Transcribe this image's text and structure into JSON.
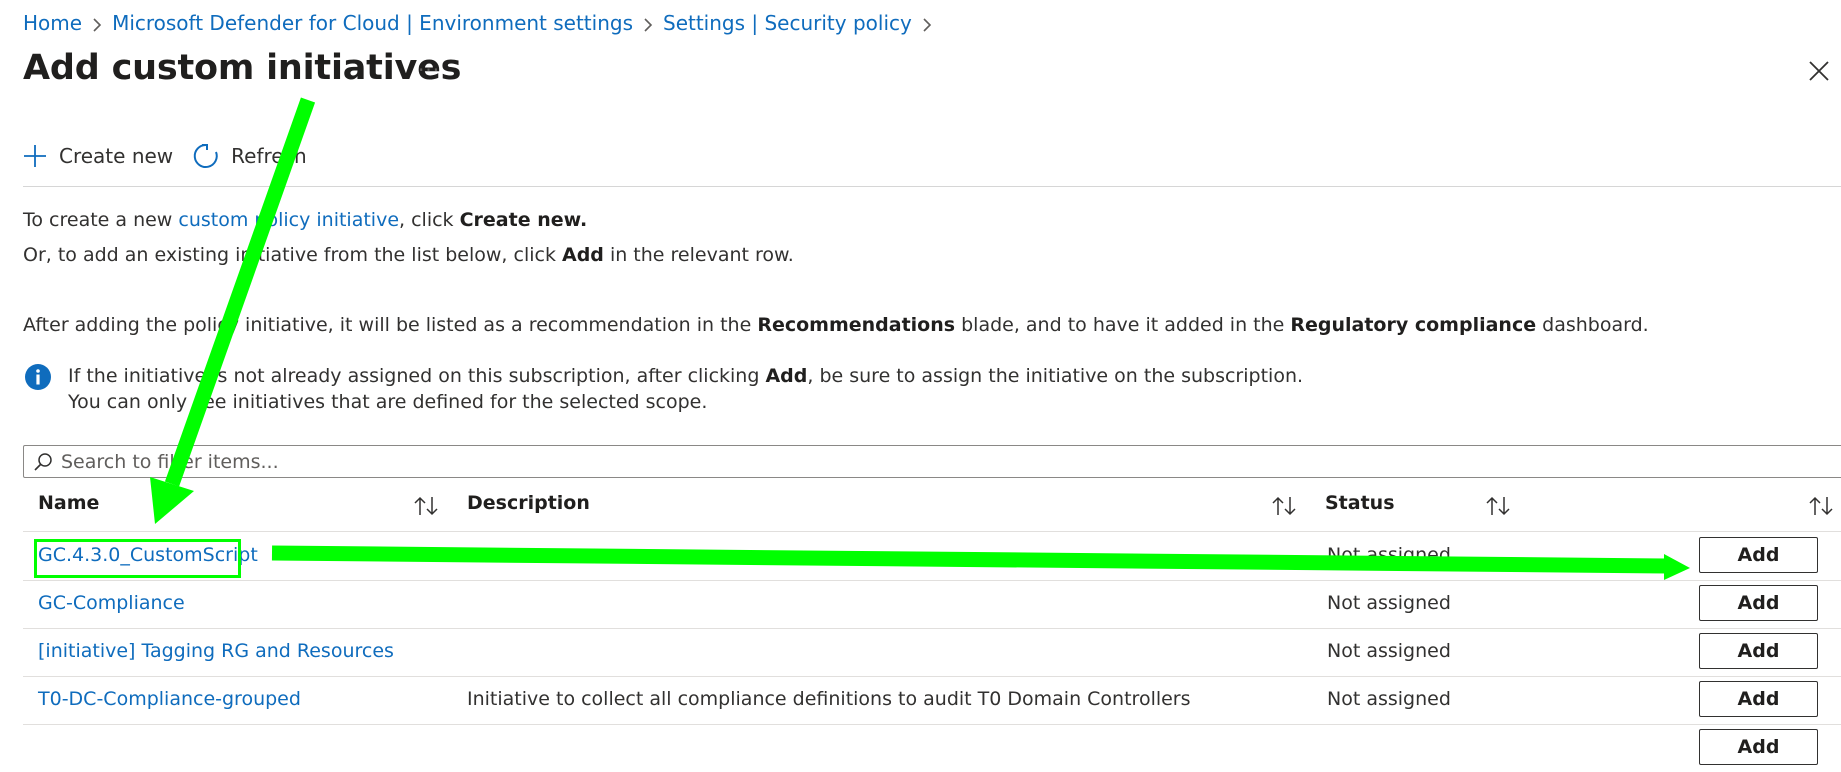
{
  "breadcrumb": [
    "Home",
    "Microsoft Defender for Cloud | Environment settings",
    "Settings | Security policy"
  ],
  "page_title": "Add custom initiatives",
  "more_label": "···",
  "toolbar": {
    "create_new": "Create new",
    "refresh": "Refresh"
  },
  "info": {
    "line1_prefix": "To create a new ",
    "line1_link": "custom policy initiative",
    "line1_mid": ", click ",
    "line1_bold": "Create new.",
    "line2_prefix": "Or, to add an existing initiative from the list below, click ",
    "line2_bold": "Add",
    "line2_suffix": " in the relevant row.",
    "line3_prefix": "After adding the policy initiative, it will be listed as a recommendation in the ",
    "line3_bold1": "Recommendations",
    "line3_mid": " blade, and to have it added in the ",
    "line3_bold2": "Regulatory compliance",
    "line3_suffix": " dashboard."
  },
  "notice": {
    "line1_prefix": "If the initiative is not already assigned on this subscription, after clicking ",
    "line1_bold": "Add",
    "line1_suffix": ", be sure to assign the initiative on the subscription.",
    "line2": "You can only see initiatives that are defined for the selected scope."
  },
  "search": {
    "placeholder": "Search to filter items..."
  },
  "table": {
    "headers": {
      "name": "Name",
      "description": "Description",
      "status": "Status"
    },
    "rows": [
      {
        "name": "GC.4.3.0_CustomScript",
        "description": "",
        "status": "Not assigned",
        "action": "Add"
      },
      {
        "name": "GC-Compliance",
        "description": "",
        "status": "Not assigned",
        "action": "Add"
      },
      {
        "name": "[initiative] Tagging RG and Resources",
        "description": "",
        "status": "Not assigned",
        "action": "Add"
      },
      {
        "name": "T0-DC-Compliance-grouped",
        "description": "Initiative to collect all compliance definitions to audit T0 Domain Controllers",
        "status": "Not assigned",
        "action": "Add"
      },
      {
        "name": "",
        "description": "",
        "status": "",
        "action": "Add"
      }
    ]
  },
  "colors": {
    "link": "#0f6cbd",
    "annotation": "#00ff00",
    "info_icon": "#0f6cbd"
  }
}
